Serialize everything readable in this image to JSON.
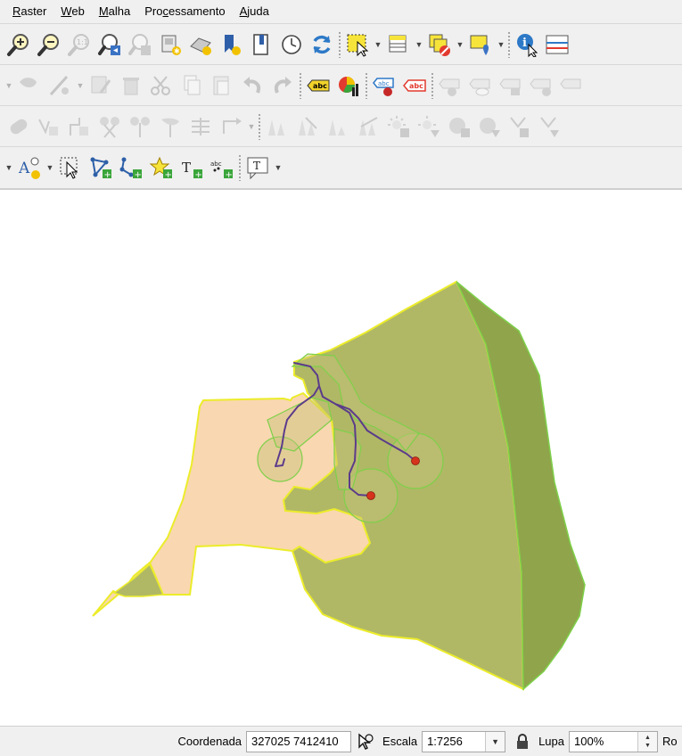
{
  "menubar": {
    "items": [
      {
        "label": "Raster",
        "accel": "R",
        "rest": "aster"
      },
      {
        "label": "Web",
        "accel": "W",
        "rest": "eb"
      },
      {
        "label": "Malha",
        "accel": "M",
        "rest": "alha"
      },
      {
        "label": "Processamento",
        "pre": "Pro",
        "accel": "c",
        "rest": "essamento"
      },
      {
        "label": "Ajuda",
        "accel": "A",
        "rest": "juda"
      }
    ]
  },
  "toolbars": {
    "navigation": [
      "zoom-in-icon",
      "zoom-out-icon",
      "zoom-native-icon",
      "zoom-last-icon",
      "zoom-next-icon",
      "new-bookmark-icon",
      "show-bookmarks-icon",
      "tile-scale-icon",
      "temporal-controller-icon",
      "refresh-icon",
      "select-features-icon",
      "open-attribute-table-icon",
      "deselect-features-icon",
      "select-location-icon",
      "identify-icon",
      "measure-icon"
    ],
    "labels": {
      "label_tool_1": "abc",
      "label_tool_2": "abc",
      "label_tool_3": "abc"
    },
    "annotation": {
      "text_tool": "T",
      "abc_tool": "abc"
    }
  },
  "map": {
    "colors": {
      "polygon_fill_light": "#f9d7b0",
      "polygon_fill_olive": "#b0b866",
      "polygon_fill_dark": "#8fa44b",
      "polygon_outline": "#ecec2a",
      "buffer_fill": "#c8c07a",
      "buffer_outline": "#7ed04a",
      "line_color": "#5b3c8a",
      "point_color": "#d6331c"
    }
  },
  "statusbar": {
    "coord_label": "Coordenada",
    "coord_value": "327025  7412410",
    "scale_label": "Escala",
    "scale_value": "1:7256",
    "magnifier_label": "Lupa",
    "magnifier_value": "100%",
    "rotation_label": "Ro"
  }
}
